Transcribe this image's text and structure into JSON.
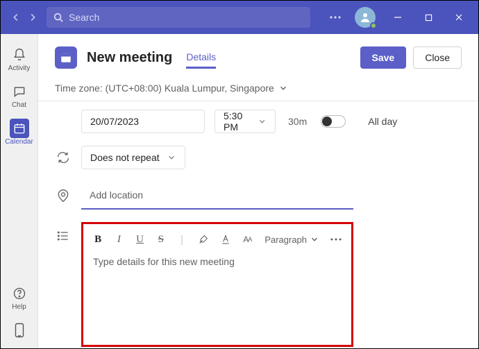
{
  "titlebar": {
    "search_placeholder": "Search"
  },
  "rail": {
    "activity": "Activity",
    "chat": "Chat",
    "calendar": "Calendar",
    "help": "Help"
  },
  "header": {
    "title": "New meeting",
    "tab_details": "Details",
    "save": "Save",
    "close": "Close"
  },
  "timezone": {
    "label": "Time zone: (UTC+08:00) Kuala Lumpur, Singapore"
  },
  "datetime": {
    "date": "20/07/2023",
    "time": "5:30 PM",
    "duration": "30m",
    "allday_label": "All day"
  },
  "repeat": {
    "value": "Does not repeat"
  },
  "location": {
    "placeholder": "Add location"
  },
  "editor": {
    "paragraph_label": "Paragraph",
    "placeholder": "Type details for this new meeting"
  }
}
